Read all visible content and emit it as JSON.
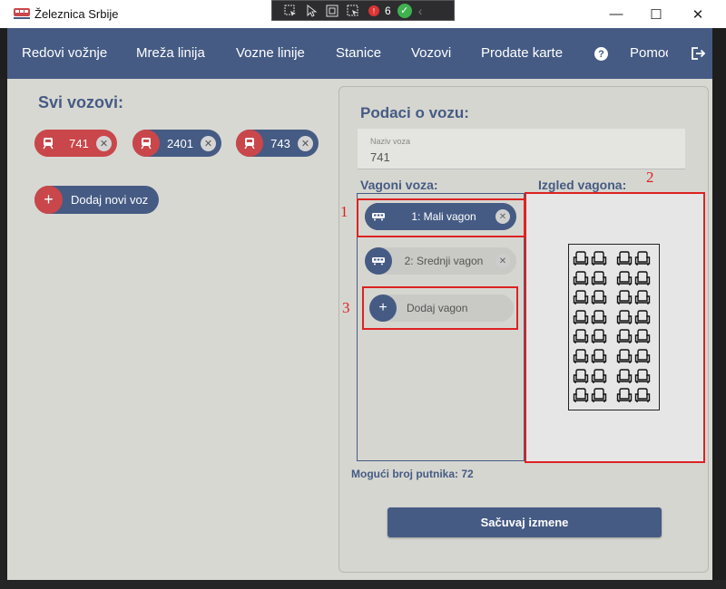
{
  "window": {
    "title": "Železnica Srbije",
    "minimize_icon": "—",
    "maximize_icon": "☐",
    "close_icon": "✕"
  },
  "debug_toolbar": {
    "count": "6"
  },
  "nav": {
    "items": [
      "Redovi vožnje",
      "Mreža linija",
      "Vozne linije",
      "Stanice",
      "Vozovi",
      "Prodate karte"
    ],
    "help_label": "Pomoć",
    "help_icon_glyph": "?"
  },
  "left": {
    "title": "Svi vozovi:",
    "trains": [
      {
        "label": "741",
        "state": "selected"
      },
      {
        "label": "2401",
        "state": "normal"
      },
      {
        "label": "743",
        "state": "normal"
      }
    ],
    "remove_glyph": "✕",
    "add_button_label": "Dodaj novi voz",
    "add_glyph": "+"
  },
  "panel": {
    "title": "Podaci o vozu:",
    "name_field": {
      "label": "Naziv voza",
      "value": "741"
    },
    "wagons_title": "Vagoni voza:",
    "layout_title": "Izgled vagona:",
    "wagons": [
      {
        "label": "1: Mali vagon",
        "selected": true
      },
      {
        "label": "2: Srednji vagon",
        "selected": false
      }
    ],
    "add_wagon_label": "Dodaj vagon",
    "capacity_text": "Mogući broj putnika: 72",
    "save_label": "Sačuvaj izmene",
    "seat_layout": {
      "rows": 8,
      "columns": 4,
      "aisle_after_column": 2
    }
  },
  "annotations": [
    "1",
    "2",
    "3"
  ],
  "colors": {
    "primary": "#455b84",
    "accent_red": "#c9474a",
    "background": "#d8d8d2",
    "annotation": "#dd2222"
  }
}
